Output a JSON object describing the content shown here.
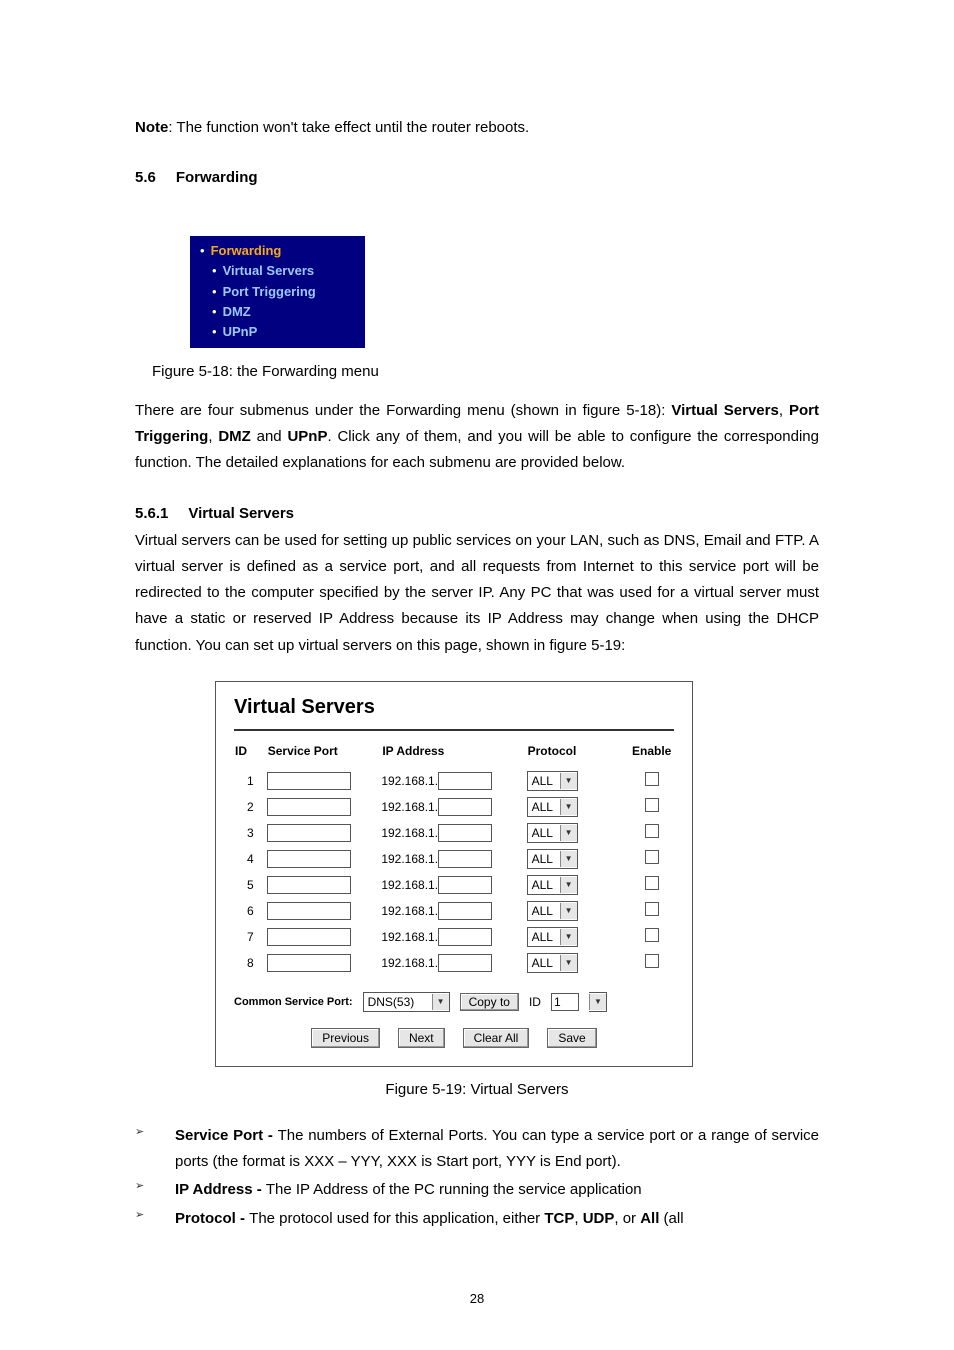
{
  "note": {
    "label": "Note",
    "text": ": The function won't take effect until the router reboots."
  },
  "section": {
    "number": "5.6",
    "title": "Forwarding"
  },
  "nav": {
    "top": "Forwarding",
    "items": [
      "Virtual Servers",
      "Port Triggering",
      "DMZ",
      "UPnP"
    ]
  },
  "fig18_caption": "Figure 5-18: the Forwarding menu",
  "para1a": "There are four submenus under the Forwarding menu (shown in figure 5-18): ",
  "para1_links": {
    "a": "Virtual Servers",
    "b": "Port Triggering",
    "c": "DMZ",
    "d": "UPnP"
  },
  "para1_mid1": ", ",
  "para1_mid2": ", ",
  "para1_mid3": " and ",
  "para1b": ". Click any of them, and you will be able to configure the corresponding function. The detailed explanations for each submenu are provided below.",
  "subsection": {
    "number": "5.6.1",
    "title": "Virtual Servers"
  },
  "para2": "Virtual servers can be used for setting up public services on your LAN, such as DNS, Email and FTP. A virtual server is defined as a service port, and all requests from Internet to this service port will be redirected to the computer specified by the server IP. Any PC that was used for a virtual server must have a static or reserved IP Address because its IP Address may change when using the DHCP function. You can set up virtual servers on this page, shown in figure 5-19:",
  "vs": {
    "title": "Virtual Servers",
    "headers": {
      "id": "ID",
      "sp": "Service Port",
      "ip": "IP Address",
      "proto": "Protocol",
      "en": "Enable"
    },
    "ip_prefix": "192.168.1.",
    "proto_value": "ALL",
    "rows": [
      1,
      2,
      3,
      4,
      5,
      6,
      7,
      8
    ],
    "csp_label": "Common Service Port:",
    "csp_value": "DNS(53)",
    "copy_btn": "Copy to",
    "id_label": "ID",
    "id_value": "1",
    "btn_prev": "Previous",
    "btn_next": "Next",
    "btn_clear": "Clear All",
    "btn_save": "Save"
  },
  "fig19_caption": "Figure 5-19: Virtual Servers",
  "bullets": {
    "b1": {
      "term": "Service Port - ",
      "rest": "The numbers of External Ports. You can type a service port or a range of service ports (the format is XXX – YYY, XXX is Start port, YYY is End port)."
    },
    "b2": {
      "term": "IP Address - ",
      "rest": "The IP Address of the PC running the service application"
    },
    "b3": {
      "term": "Protocol - ",
      "rest_a": "The protocol used for this application, either ",
      "tcp": "TCP",
      "mid1": ", ",
      "udp": "UDP",
      "mid2": ", or ",
      "all": "All",
      "rest_b": " (all"
    }
  },
  "page_number": "28",
  "chevron": "▼"
}
